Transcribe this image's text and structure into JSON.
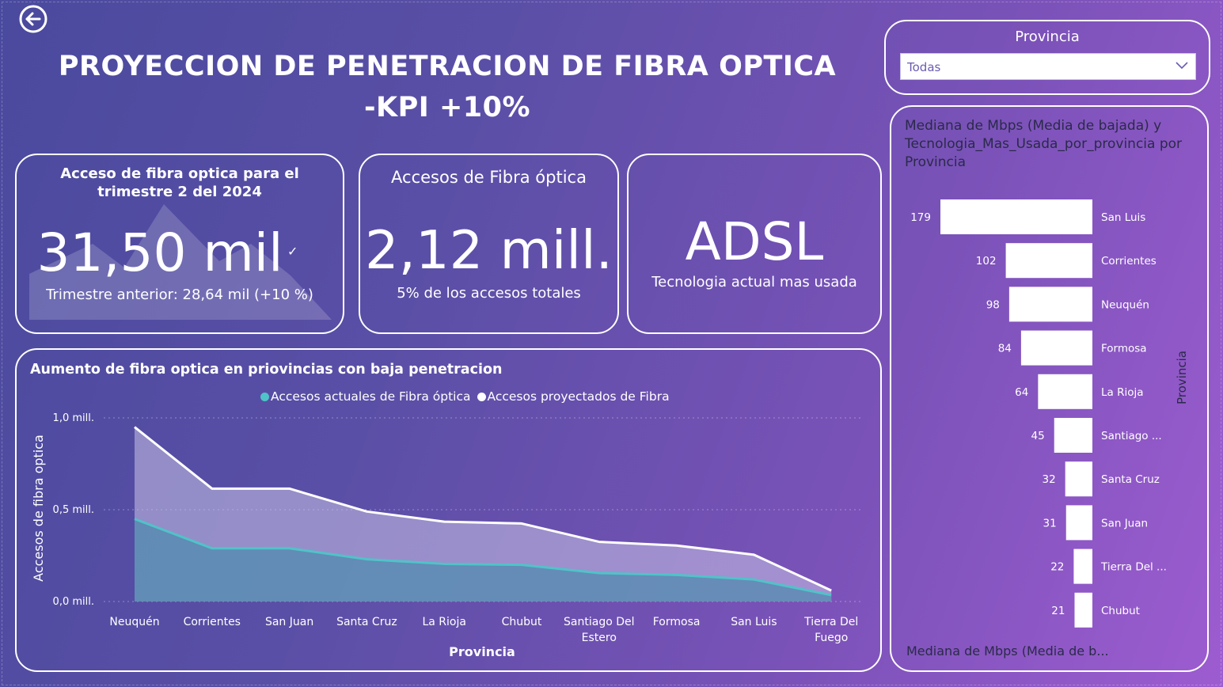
{
  "header": {
    "title_line1": "PROYECCION DE PENETRACION DE FIBRA OPTICA",
    "title_line2": "-KPI +10%",
    "back_icon": "arrow-left-circle-icon"
  },
  "kpis": {
    "quarter": {
      "title": "Acceso de fibra optica para el trimestre 2 del 2024",
      "value": "31,50 mil",
      "status_icon": "check-icon",
      "sub": "Trimestre anterior: 28,64 mil (+10 %)"
    },
    "total": {
      "title": "Accesos de Fibra óptica",
      "value": "2,12 mill.",
      "sub": "5% de los accesos totales"
    },
    "tech": {
      "value": "ADSL",
      "sub": "Tecnologia actual mas usada"
    }
  },
  "slicer": {
    "title": "Provincia",
    "selected": "Todas",
    "icon": "chevron-down-icon"
  },
  "colors": {
    "actual": "#4fc3c8",
    "projected": "#ffffff",
    "bar": "#ffffff",
    "dark_text": "#2b2a4a"
  },
  "chart_data": [
    {
      "type": "area",
      "title": "Aumento de fibra optica en priovincias con baja penetracion",
      "xlabel": "Provincia",
      "ylabel": "Accesos de fibra optica",
      "ylim": [
        0,
        1000000
      ],
      "yticks": [
        "0,0 mill.",
        "0,5 mill.",
        "1,0 mill."
      ],
      "grid": true,
      "legend_position": "top",
      "categories": [
        "Neuquén",
        "Corrientes",
        "San Juan",
        "Santa Cruz",
        "La Rioja",
        "Chubut",
        "Santiago Del Estero",
        "Formosa",
        "San Luis",
        "Tierra Del Fuego"
      ],
      "series": [
        {
          "name": "Accesos actuales de Fibra óptica",
          "values": [
            450000,
            290000,
            290000,
            230000,
            205000,
            200000,
            155000,
            145000,
            120000,
            35000
          ]
        },
        {
          "name": "Accesos proyectados de Fibra",
          "values": [
            950000,
            615000,
            615000,
            490000,
            435000,
            425000,
            325000,
            305000,
            255000,
            60000
          ]
        }
      ]
    },
    {
      "type": "bar",
      "orientation": "horizontal",
      "title": "Mediana de Mbps (Media de bajada) y Tecnologia_Mas_Usada_por_provincia por Provincia",
      "xlabel": "Mediana de Mbps (Media de b...",
      "ylabel": "Provincia",
      "categories": [
        "San Luis",
        "Corrientes",
        "Neuquén",
        "Formosa",
        "La Rioja",
        "Santiago ...",
        "Santa Cruz",
        "San Juan",
        "Tierra Del ...",
        "Chubut"
      ],
      "values": [
        179,
        102,
        98,
        84,
        64,
        45,
        32,
        31,
        22,
        21
      ]
    }
  ]
}
